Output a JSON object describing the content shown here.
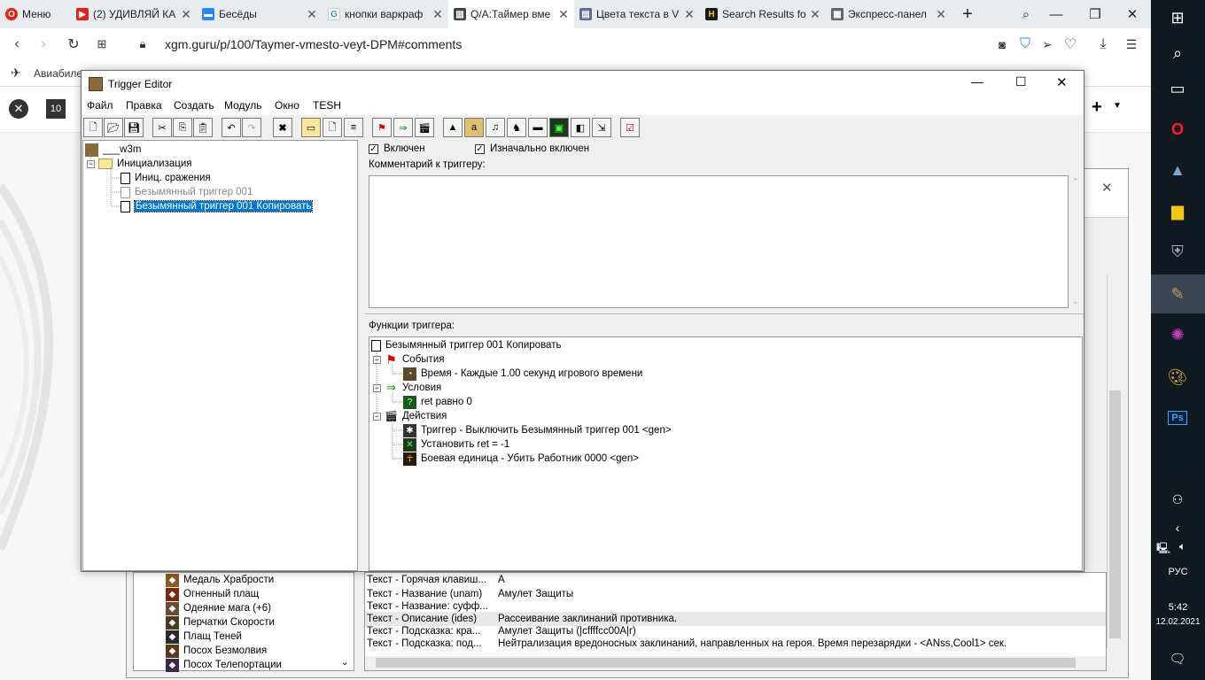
{
  "browser": {
    "menu_label": "Меню",
    "tabs": [
      {
        "label": "(2) УДИВЛЯЙ КА",
        "color": "#e62117"
      },
      {
        "label": "Бесёды",
        "color": "#2b87f0"
      },
      {
        "label": "кнопки варкраф",
        "color": "#4285f4"
      },
      {
        "label": "Q/A:Таймер вме",
        "color": "#444444"
      },
      {
        "label": "Цвета текста в V",
        "color": "#5a6d96"
      },
      {
        "label": "Search Results fo",
        "color": "#1a1a1a"
      },
      {
        "label": "Экспресс-панел",
        "color": "#666666"
      }
    ],
    "url": "xgm.guru/p/100/Taymer-vmesto-veyt-DPM#comments",
    "bookmark_label": "Авиабиле"
  },
  "site": {
    "badge": "10"
  },
  "trigger_editor": {
    "title": "Trigger Editor",
    "menu": [
      "Файл",
      "Правка",
      "Создать",
      "Модуль",
      "Окно",
      "TESH"
    ],
    "tree": {
      "root": "___w3m",
      "folder": "Инициализация",
      "items": [
        {
          "label": "Иниц. сражения",
          "disabled": false
        },
        {
          "label": "Безымянный триггер 001",
          "disabled": true
        },
        {
          "label": "Безымянный триггер 001 Копировать",
          "disabled": false,
          "selected": true
        }
      ]
    },
    "enabled_label": "Включен",
    "initially_enabled_label": "Изначально включен",
    "comment_label": "Комментарий к триггеру:",
    "functions_label": "Функции триггера:",
    "functions": {
      "trigger_name": "Безымянный триггер 001 Копировать",
      "events_label": "События",
      "event_item": "Время - Каждые 1.00 секунд игрового времени",
      "conditions_label": "Условия",
      "condition_item": "ret равно 0",
      "actions_label": "Действия",
      "action_items": [
        "Триггер - Выключить Безымянный триггер 001 <gen>",
        "Установить ret = -1",
        "Боевая единица - Убить Работник 0000 <gen>"
      ]
    }
  },
  "background_editor": {
    "items": [
      "Медаль Храбрости",
      "Огненный плащ",
      "Одеяние мага (+6)",
      "Перчатки Скорости",
      "Плащ Теней",
      "Посох Безмолвия",
      "Посох Телепортации"
    ],
    "rows": [
      {
        "field": "Текст - Горячая клавиш...",
        "value": "A"
      },
      {
        "field": "Текст - Название (unam)",
        "value": "Амулет Защиты"
      },
      {
        "field": "Текст - Название: суфф...",
        "value": ""
      },
      {
        "field": "Текст - Описание (ides)",
        "value": "Рассеивание заклинаний противника."
      },
      {
        "field": "Текст - Подсказка: кра...",
        "value": "Амулет Защиты (|cffffcc00A|r)"
      },
      {
        "field": "Текст - Подсказка: под...",
        "value": "Нейтрализация вредоносных заклинаний, направленных на героя. Время перезарядки - <ANss,Cool1> сек."
      }
    ]
  },
  "taskbar": {
    "lang": "РУС",
    "time": "5:42",
    "date": "12.02.2021"
  }
}
